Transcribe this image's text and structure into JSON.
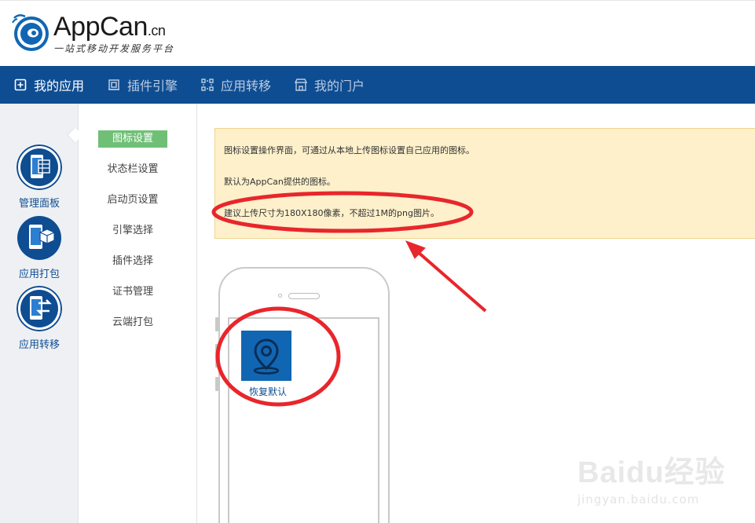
{
  "brand": {
    "name": "AppCan",
    "suffix": ".cn",
    "tagline": "一站式移动开发服务平台",
    "color": "#0f4d92"
  },
  "nav": {
    "items": [
      {
        "label": "我的应用",
        "icon": "plus-square-icon",
        "active": true
      },
      {
        "label": "插件引擎",
        "icon": "plugin-icon",
        "active": false
      },
      {
        "label": "应用转移",
        "icon": "transfer-icon",
        "active": false
      },
      {
        "label": "我的门户",
        "icon": "store-icon",
        "active": false
      }
    ]
  },
  "sidebar": {
    "items": [
      {
        "label": "管理面板",
        "icon": "dashboard-phone-icon",
        "active": false
      },
      {
        "label": "应用打包",
        "icon": "package-phone-icon",
        "active": true
      },
      {
        "label": "应用转移",
        "icon": "transfer-phone-icon",
        "active": false
      }
    ]
  },
  "submenu": {
    "items": [
      {
        "label": "图标设置",
        "active": true
      },
      {
        "label": "状态栏设置",
        "active": false
      },
      {
        "label": "启动页设置",
        "active": false
      },
      {
        "label": "引擎选择",
        "active": false
      },
      {
        "label": "插件选择",
        "active": false
      },
      {
        "label": "证书管理",
        "active": false
      },
      {
        "label": "云端打包",
        "active": false
      }
    ]
  },
  "notice": {
    "line1": "图标设置操作界面，可通过从本地上传图标设置自己应用的图标。",
    "line2": "默认为AppCan提供的图标。",
    "line3": "建议上传尺寸为180X180像素，不超过1M的png图片。"
  },
  "preview": {
    "app_icon": "location-pin-icon",
    "app_label": "恢复默认"
  },
  "watermark": {
    "main": "Baidu经验",
    "sub": "jingyan.baidu.com"
  },
  "colors": {
    "nav_bg": "#0f4d92",
    "active_green": "#6fc076",
    "notice_bg": "#fdf0cb",
    "annotation_red": "#e8262b"
  }
}
